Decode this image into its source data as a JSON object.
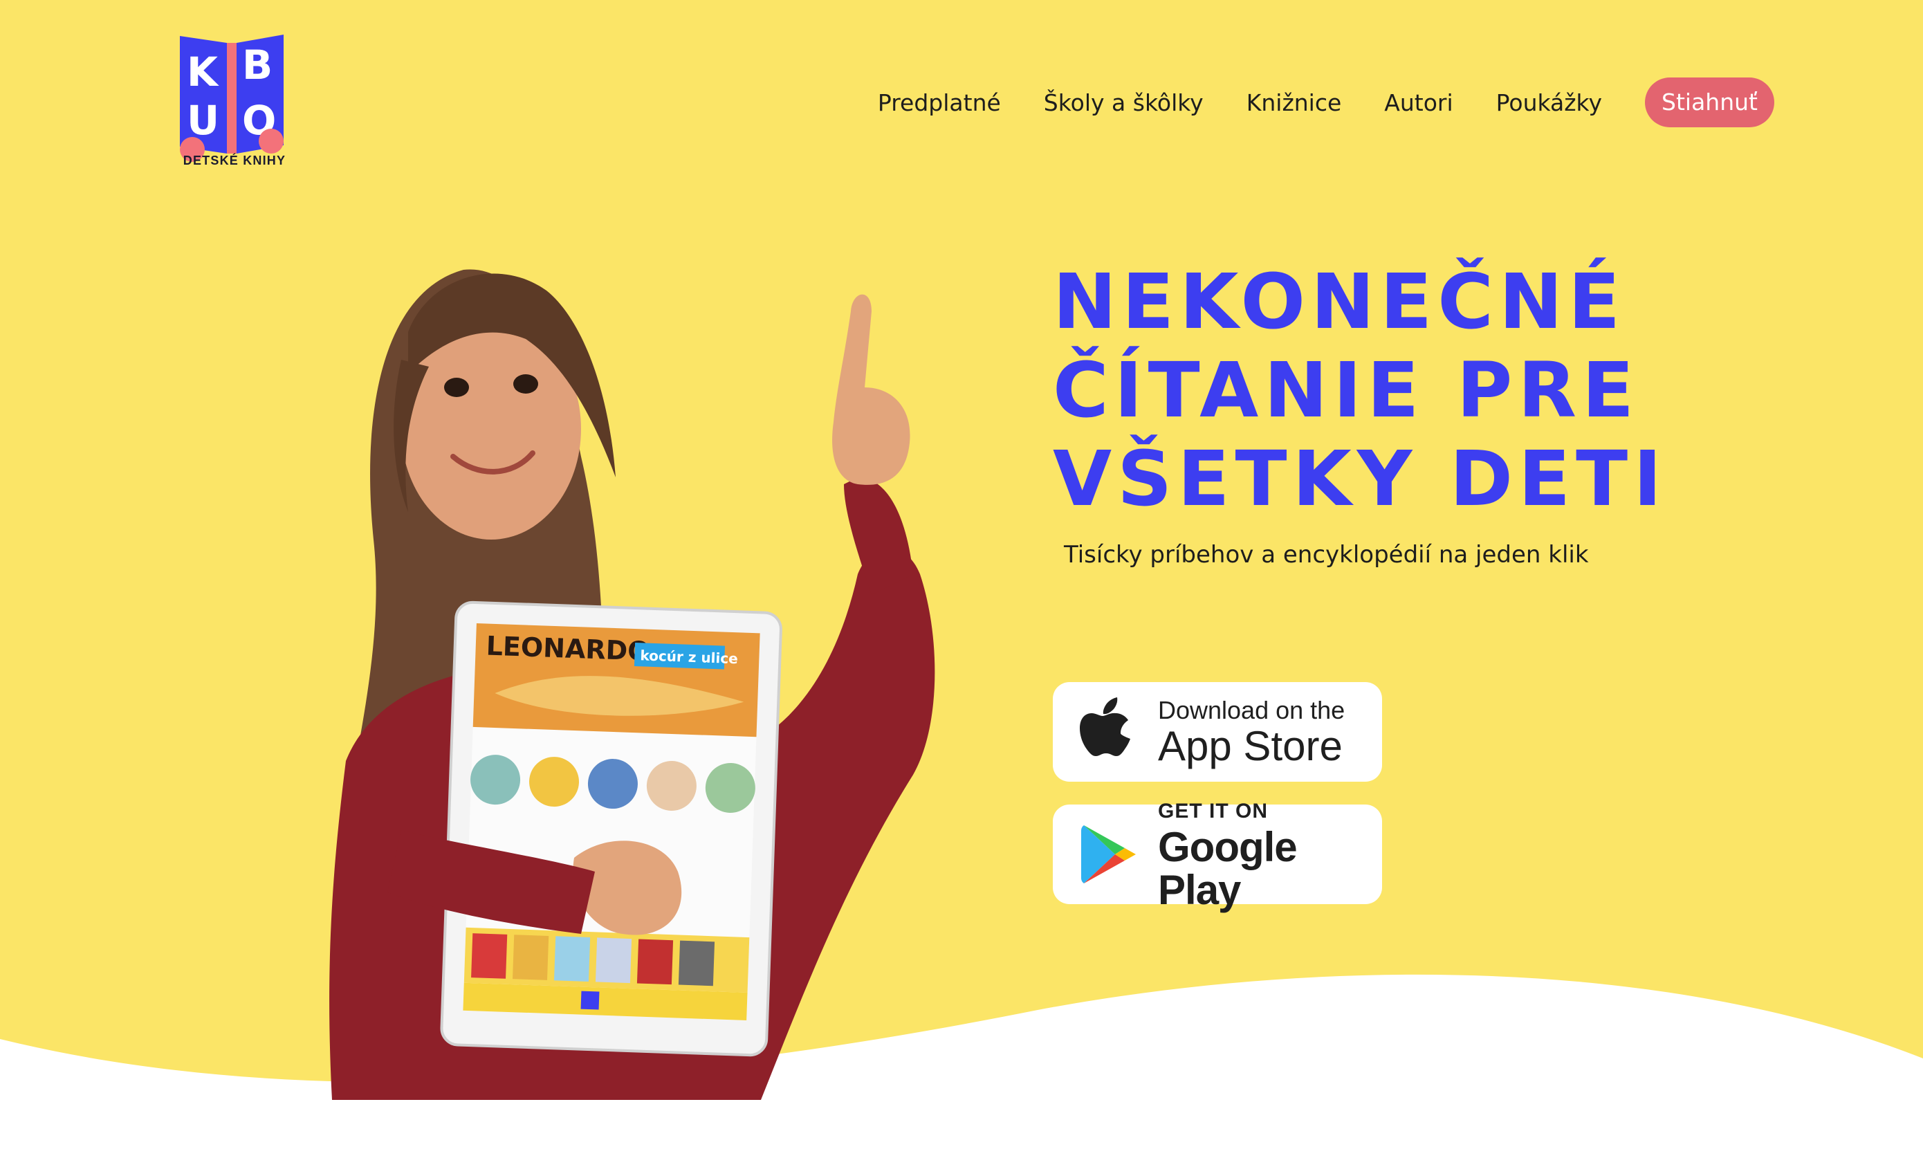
{
  "brand": {
    "logo_letters": [
      "K",
      "B",
      "U",
      "O"
    ],
    "caption": "DETSKÉ KNIHY",
    "colors": {
      "logo_blue": "#3d3ef0",
      "logo_pink": "#f3727a"
    }
  },
  "nav": {
    "items": [
      "Predplatné",
      "Školy a škôlky",
      "Knižnice",
      "Autori",
      "Poukážky"
    ],
    "cta": "Stiahnuť"
  },
  "hero": {
    "headline": [
      "NEKONEČNÉ",
      "ČÍTANIE PRE",
      "VŠETKY DETI"
    ],
    "subtitle": "Tisícky príbehov a encyklopédií na jeden klik",
    "background": "#fbe567",
    "accent": "#3d3ef0",
    "cta_color": "#e3646f"
  },
  "tablet": {
    "banner_title": "LEONARDO",
    "banner_tag": "kocúr z ulice"
  },
  "badges": {
    "appstore": {
      "small": "Download on the",
      "big": "App Store",
      "icon": "apple-icon"
    },
    "gplay": {
      "small": "GET IT ON",
      "big": "Google Play",
      "icon": "google-play-icon"
    }
  }
}
